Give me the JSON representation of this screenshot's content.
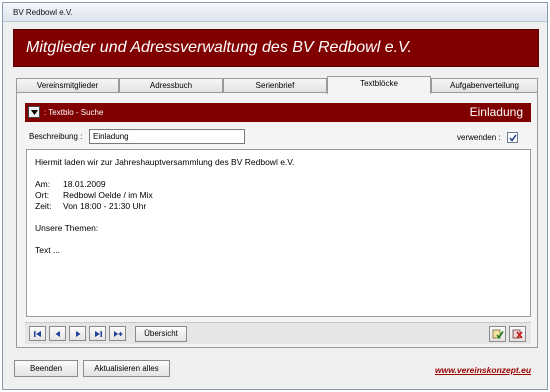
{
  "window": {
    "title": "BV Redbowl e.V."
  },
  "header": {
    "title": "Mitglieder und Adressverwaltung des BV Redbowl e.V."
  },
  "tabs": [
    {
      "label": "Vereinsmitglieder",
      "active": false
    },
    {
      "label": "Adressbuch",
      "active": false
    },
    {
      "label": "Serienbrief",
      "active": false
    },
    {
      "label": "Textblöcke",
      "active": true
    },
    {
      "label": "Aufgabenverteilung",
      "active": false
    }
  ],
  "textblock": {
    "search_label": ": Textblo - Suche",
    "selected": "Einladung",
    "description_label": "Beschreibung :",
    "description_value": "Einladung",
    "use_label": "verwenden :",
    "use_checked": true
  },
  "body_text": {
    "line1": "Hiermit laden wir zur Jahreshauptversammlung des BV Redbowl e.V.",
    "date_key": "Am:",
    "date_val": "18.01.2009",
    "place_key": "Ort:",
    "place_val": "Redbowl Oelde / im Mix",
    "time_key": "Zeit:",
    "time_val": "Von 18:00 - 21:30 Uhr",
    "topics": "Unsere Themen:",
    "text": "Text ..."
  },
  "navigation": {
    "overview_label": "Übersicht",
    "icons": [
      "first-record-icon",
      "previous-record-icon",
      "next-record-icon",
      "last-record-icon",
      "new-record-icon",
      "save-record-icon",
      "delete-record-icon"
    ]
  },
  "footer": {
    "quit_label": "Beenden",
    "refresh_label": "Aktualisieren alles",
    "link": "www.vereinskonzept.eu"
  },
  "colors": {
    "brand": "#800000",
    "link": "#990000"
  }
}
